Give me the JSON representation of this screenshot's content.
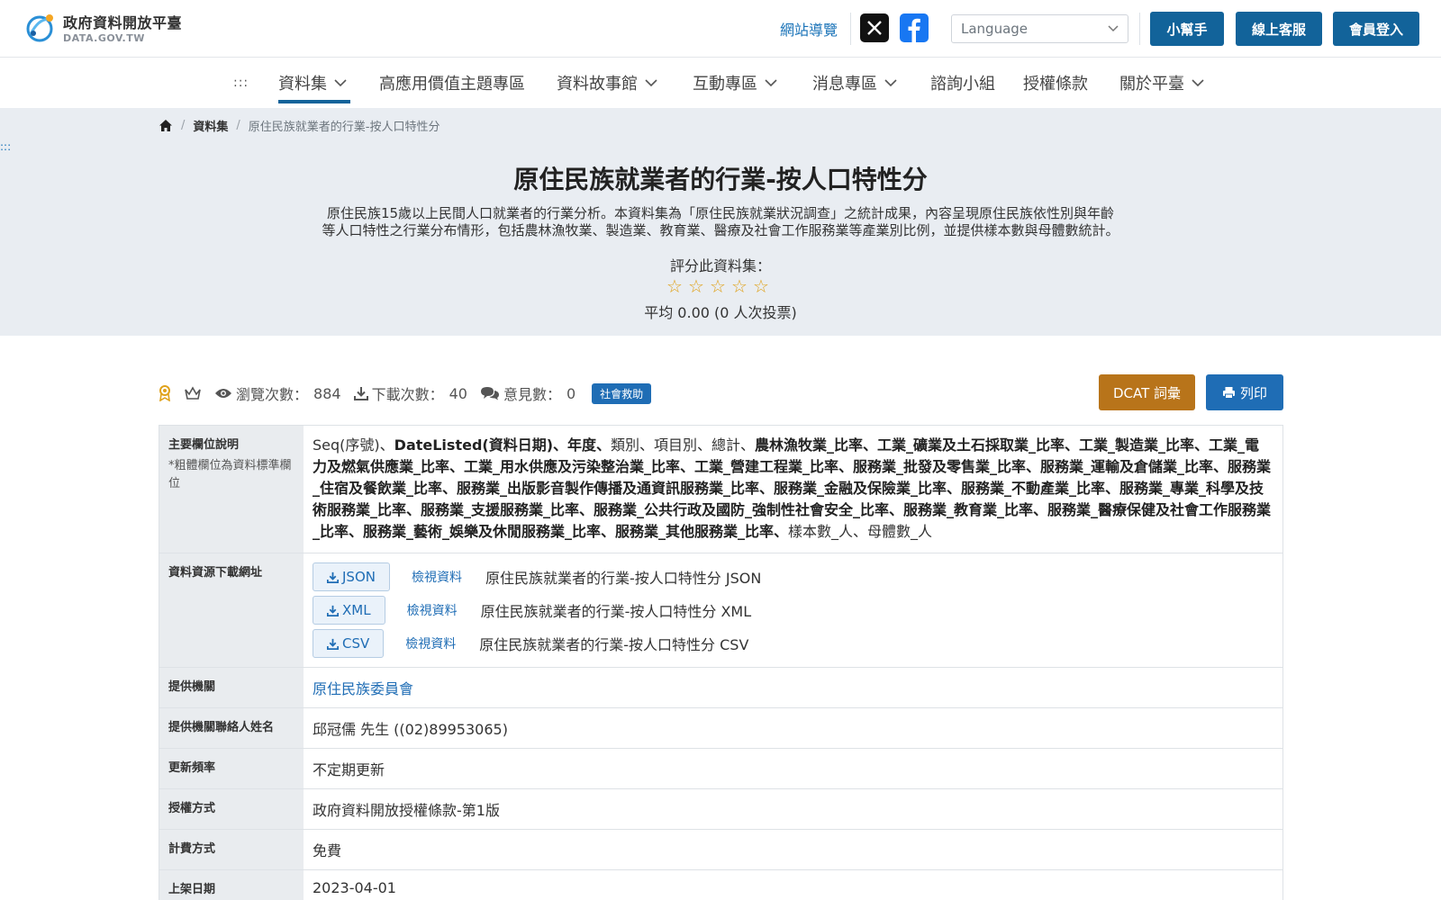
{
  "header": {
    "logo_cn": "政府資料開放平臺",
    "logo_en": "DATA.GOV.TW",
    "site_nav": "網站導覽",
    "language_placeholder": "Language",
    "buttons": {
      "helper": "小幫手",
      "support": "線上客服",
      "login": "會員登入"
    },
    "colors": {
      "primary": "#12639a",
      "accent": "#1f6db5",
      "dcat": "#b8741a"
    }
  },
  "nav": {
    "dots": ":::",
    "items": [
      {
        "label": "資料集"
      },
      {
        "label": "高應用價值主題專區"
      },
      {
        "label": "資料故事館"
      },
      {
        "label": "互動專區"
      },
      {
        "label": "消息專區"
      },
      {
        "label": "諮詢小組"
      },
      {
        "label": "授權條款"
      },
      {
        "label": "關於平臺"
      }
    ]
  },
  "breadcrumb": {
    "datasets": "資料集",
    "current": "原住民族就業者的行業-按人口特性分"
  },
  "hero": {
    "dots": ":::",
    "title": "原住民族就業者的行業-按人口特性分",
    "desc_line1": "原住民族15歲以上民間人口就業者的行業分析。本資料集為「原住民族就業狀況調查」之統計成果，內容呈現原住民族依性別與年齡",
    "desc_line2": "等人口特性之行業分布情形，包括農林漁牧業、製造業、教育業、醫療及社會工作服務業等產業別比例，並提供樣本數與母體數統計。",
    "rate_label": "評分此資料集：",
    "stars": "☆☆☆☆☆",
    "rating": "平均 0.00 (0 人次投票)"
  },
  "stats": {
    "views_label": "瀏覽次數：",
    "views": "884",
    "downloads_label": "下載次數：",
    "downloads": "40",
    "comments_label": "意見數：",
    "comments": "0",
    "tag": "社會救助",
    "dcat_button": "DCAT 詞彙",
    "print_button": "列印"
  },
  "table": {
    "fields_label": "主要欄位說明",
    "fields_note": "*粗體欄位為資料標準欄位",
    "fields_parts": {
      "p1": "Seq(序號)、",
      "b1": "DateListed(資料日期)、年度、",
      "p2": "類別、項目別、總計、",
      "b2": "農林漁牧業_比率、工業_礦業及土石採取業_比率、工業_製造業_比率、工業_電力及燃氣供應業_比率、工業_用水供應及污染整治業_比率、工業_營建工程業_比率、服務業_批發及零售業_比率、服務業_運輸及倉儲業_比率、服務業_住宿及餐飲業_比率、服務業_出版影音製作傳播及通資訊服務業_比率、服務業_金融及保險業_比率、服務業_不動產業_比率、服務業_專業_科學及技術服務業_比率、服務業_支援服務業_比率、服務業_公共行政及國防_強制性社會安全_比率、服務業_教育業_比率、服務業_醫療保健及社會工作服務業_比率、服務業_藝術_娛樂及休閒服務業_比率、服務業_其他服務業_比率、",
      "p3": "樣本數_人、母體數_人"
    },
    "resources_label": "資料資源下載網址",
    "resources": [
      {
        "format": "JSON",
        "view": "檢視資料",
        "name": "原住民族就業者的行業-按人口特性分 JSON"
      },
      {
        "format": "XML",
        "view": "檢視資料",
        "name": "原住民族就業者的行業-按人口特性分 XML"
      },
      {
        "format": "CSV",
        "view": "檢視資料",
        "name": "原住民族就業者的行業-按人口特性分 CSV"
      }
    ],
    "org_label": "提供機關",
    "org": "原住民族委員會",
    "contact_label": "提供機關聯絡人姓名",
    "contact": "邱冠儒 先生 ((02)89953065)",
    "freq_label": "更新頻率",
    "freq": "不定期更新",
    "license_label": "授權方式",
    "license": "政府資料開放授權條款-第1版",
    "fee_label": "計費方式",
    "fee": "免費",
    "listed_label": "上架日期",
    "listed": "2023-04-01"
  }
}
